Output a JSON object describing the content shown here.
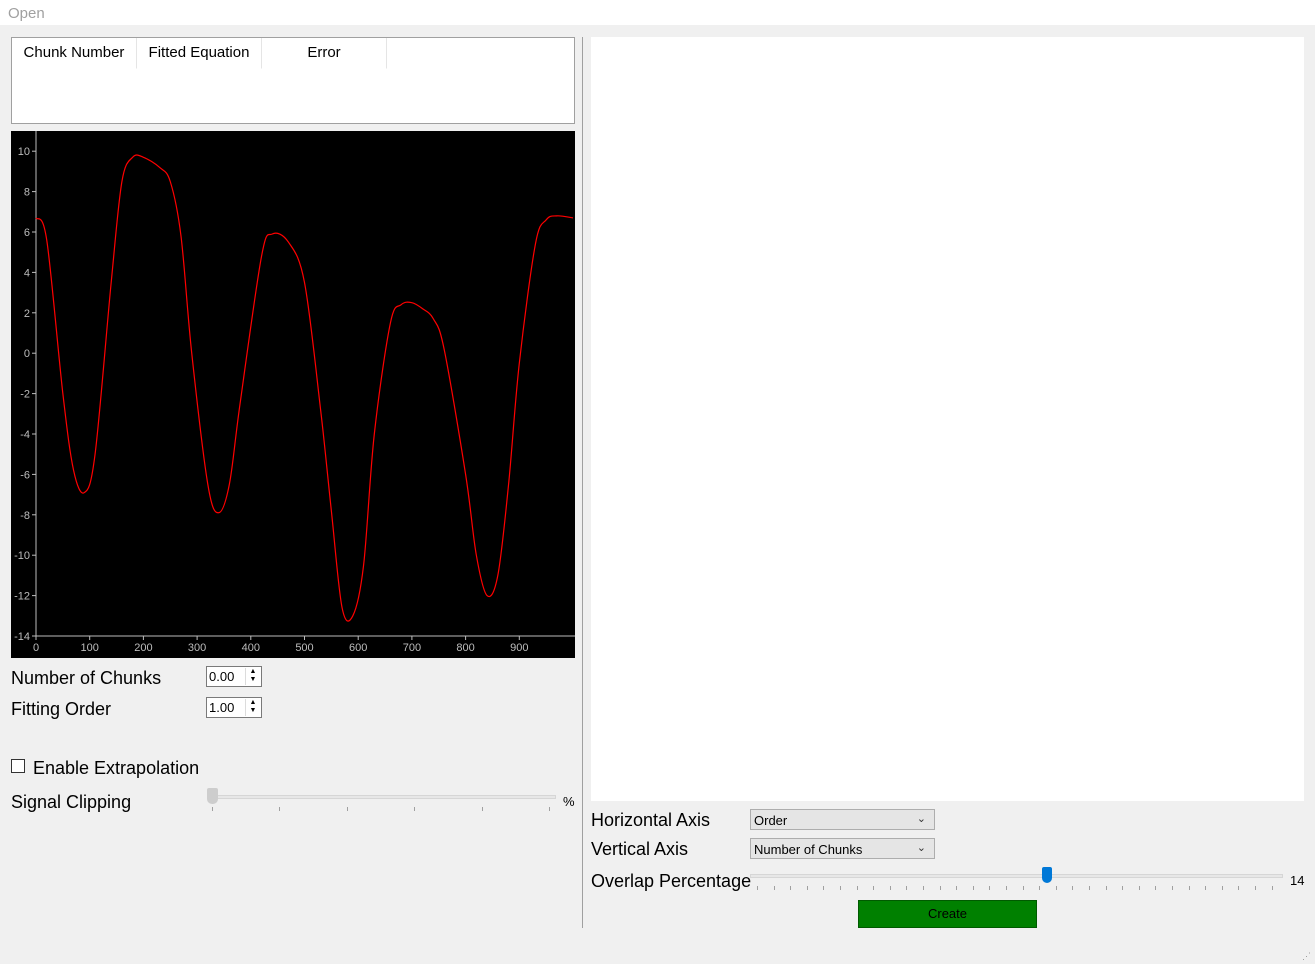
{
  "menu": {
    "open_label": "Open"
  },
  "table": {
    "headers": [
      "Chunk Number",
      "Fitted Equation",
      "Error"
    ]
  },
  "controls": {
    "chunks_label": "Number of Chunks",
    "chunks_value": "0.00",
    "order_label": "Fitting Order",
    "order_value": "1.00",
    "extrapolation_label": "Enable Extrapolation",
    "extrapolation_checked": false,
    "clipping_label": "Signal Clipping",
    "clipping_unit": "%",
    "clipping_value": 0
  },
  "right": {
    "horizontal_label": "Horizontal Axis",
    "horizontal_value": "Order",
    "vertical_label": "Vertical Axis",
    "vertical_value": "Number of Chunks",
    "overlap_label": "Overlap Percentage",
    "overlap_value": "14",
    "create_label": "Create"
  },
  "chart_data": {
    "type": "line",
    "xlim": [
      0,
      1000
    ],
    "ylim": [
      -14,
      11
    ],
    "x_ticks": [
      "0",
      "100",
      "200",
      "300",
      "400",
      "500",
      "600",
      "700",
      "800",
      "900"
    ],
    "y_ticks": [
      "10",
      "8",
      "6",
      "4",
      "2",
      "0",
      "-2",
      "-4",
      "-6",
      "-8",
      "-10",
      "-12",
      "-14"
    ],
    "line_color": "#ff0000",
    "background": "#000000",
    "series": [
      {
        "x": [
          0,
          20,
          50,
          70,
          90,
          110,
          140,
          160,
          180,
          200,
          230,
          250,
          270,
          290,
          320,
          340,
          360,
          380,
          420,
          440,
          470,
          500,
          530,
          550,
          570,
          590,
          610,
          630,
          660,
          680,
          700,
          720,
          740,
          760,
          800,
          820,
          840,
          860,
          880,
          900,
          930,
          950,
          970,
          1000
        ],
        "y": [
          6.7,
          5.6,
          -2,
          -5.8,
          -6.9,
          -5,
          3.5,
          8.5,
          9.7,
          9.7,
          9.2,
          8.5,
          5.8,
          0,
          -6.5,
          -7.9,
          -6.5,
          -2.5,
          4.8,
          5.9,
          5.5,
          3.5,
          -2.8,
          -7.8,
          -12.6,
          -13,
          -10.5,
          -4,
          1.5,
          2.4,
          2.5,
          2.2,
          1.7,
          0.2,
          -6,
          -10,
          -12,
          -11,
          -6.5,
          -0.5,
          5.4,
          6.6,
          6.8,
          6.7
        ]
      }
    ]
  }
}
